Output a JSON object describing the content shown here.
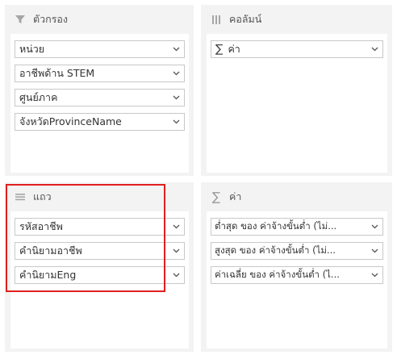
{
  "areas": {
    "filters": {
      "title": "ตัวกรอง",
      "icon": "filter-icon",
      "fields": [
        "หน่วย",
        "อาชีพด้าน STEM",
        "ศูนย์ภาค",
        "จังหวัดProvinceName"
      ]
    },
    "columns": {
      "title": "คอลัมน์",
      "icon": "columns-icon",
      "fields": [
        "ค่า"
      ]
    },
    "rows": {
      "title": "แถว",
      "icon": "rows-icon",
      "fields": [
        "รหัสอาชีพ",
        "คำนิยามอาชีพ",
        "คำนิยามEng"
      ]
    },
    "values": {
      "title": "ค่า",
      "icon": "sigma-icon",
      "fields": [
        "ต่ำสุด ของ ค่าจ้างขั้นต่ำ (ไม่...",
        "สูงสุด ของ ค่าจ้างขั้นต่ำ (ไม่...",
        "ค่าเฉลี่ย ของ ค่าจ้างขั้นต่ำ (ไ..."
      ]
    }
  },
  "colors": {
    "highlight": "#e0201f",
    "panel_bg": "#f3f3f3",
    "field_border": "#c8c8c8"
  }
}
